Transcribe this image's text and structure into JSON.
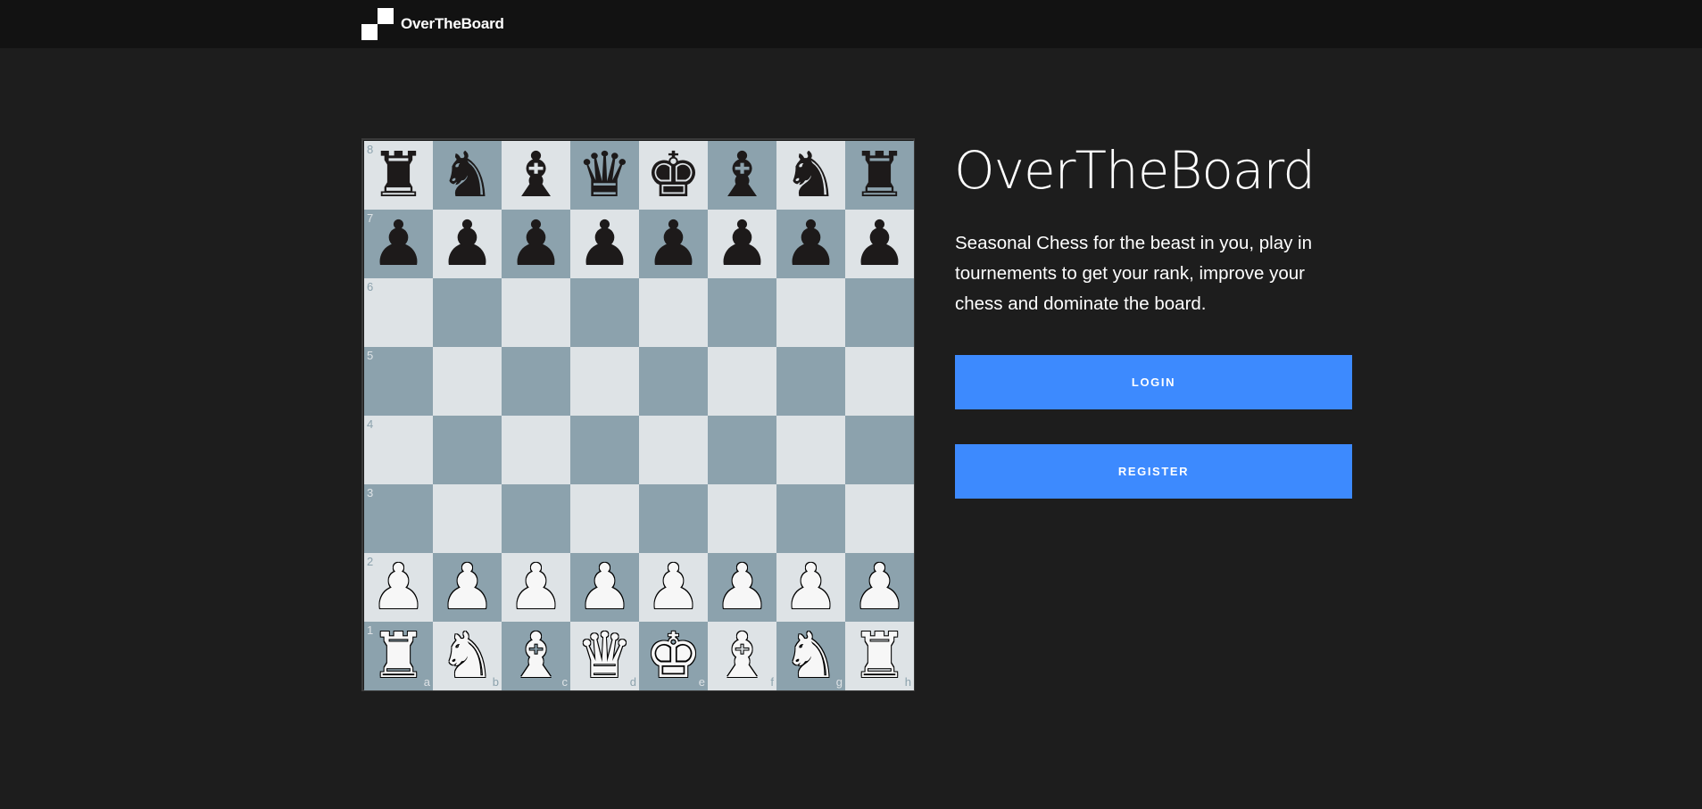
{
  "header": {
    "brand_name": "OverTheBoard"
  },
  "board": {
    "ranks": [
      "8",
      "7",
      "6",
      "5",
      "4",
      "3",
      "2",
      "1"
    ],
    "files": [
      "a",
      "b",
      "c",
      "d",
      "e",
      "f",
      "g",
      "h"
    ],
    "light_color": "#dee3e6",
    "dark_color": "#8ca2ad",
    "rows": [
      [
        "black-rook",
        "black-knight",
        "black-bishop",
        "black-queen",
        "black-king",
        "black-bishop",
        "black-knight",
        "black-rook"
      ],
      [
        "black-pawn",
        "black-pawn",
        "black-pawn",
        "black-pawn",
        "black-pawn",
        "black-pawn",
        "black-pawn",
        "black-pawn"
      ],
      [
        "",
        "",
        "",
        "",
        "",
        "",
        "",
        ""
      ],
      [
        "",
        "",
        "",
        "",
        "",
        "",
        "",
        ""
      ],
      [
        "",
        "",
        "",
        "",
        "",
        "",
        "",
        ""
      ],
      [
        "",
        "",
        "",
        "",
        "",
        "",
        "",
        ""
      ],
      [
        "white-pawn",
        "white-pawn",
        "white-pawn",
        "white-pawn",
        "white-pawn",
        "white-pawn",
        "white-pawn",
        "white-pawn"
      ],
      [
        "white-rook",
        "white-knight",
        "white-bishop",
        "white-queen",
        "white-king",
        "white-bishop",
        "white-knight",
        "white-rook"
      ]
    ]
  },
  "hero": {
    "title": "OverTheBoard",
    "description": "Seasonal Chess for the beast in you, play in tournements to get your rank, improve your chess and dominate the board."
  },
  "actions": {
    "login_label": "LOGIN",
    "register_label": "REGISTER"
  },
  "colors": {
    "background": "#1d1d1d",
    "topbar": "#121212",
    "accent": "#3d8afe"
  }
}
